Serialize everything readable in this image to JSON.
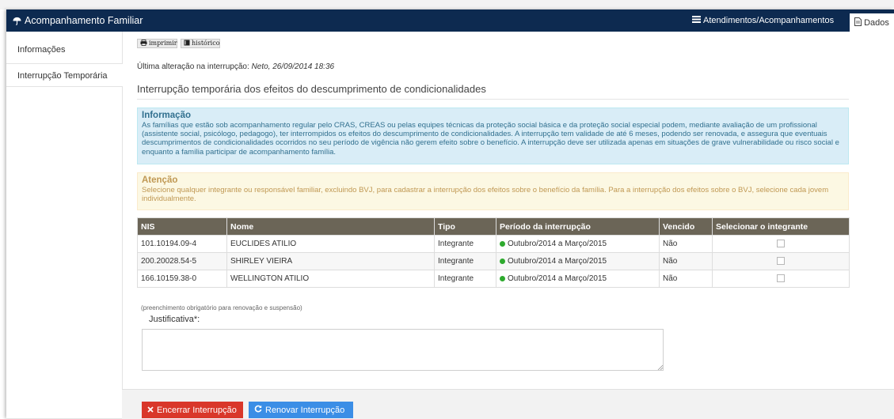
{
  "header": {
    "title": "Acompanhamento Familiar",
    "tabs": [
      {
        "label": "Atendimentos/Acompanhamentos",
        "icon": "list-icon"
      },
      {
        "label": "Dados",
        "icon": "document-icon",
        "active": true
      }
    ]
  },
  "sidebar": {
    "items": [
      {
        "label": "Informações"
      },
      {
        "label": "Interrupção Temporária",
        "active": true
      }
    ]
  },
  "toolbar": {
    "print_label": "imprimir",
    "history_label": "histórico"
  },
  "last_change": {
    "prefix": "Última alteração na interrupção:",
    "value": "Neto, 26/09/2014 18:36"
  },
  "page_title": "Interrupção temporária dos efeitos do descumprimento de condicionalidades",
  "info_alert": {
    "title": "Informação",
    "text": "As famílias que estão sob acompanhamento regular pelo CRAS, CREAS ou pelas equipes técnicas da proteção social básica e da proteção social especial podem, mediante avaliação de um profissional (assistente social, psicólogo, pedagogo), ter interrompidos os efeitos do descumprimento de condicionalidades. A interrupção tem validade de até 6 meses, podendo ser renovada, e assegura que eventuais descumprimentos de condicionalidades ocorridos no seu período de vigência não gerem efeito sobre o benefício. A interrupção deve ser utilizada apenas em situações de grave vulnerabilidade ou risco social e enquanto a família participar de acompanhamento família."
  },
  "warning_alert": {
    "title": "Atenção",
    "text": "Selecione qualquer integrante ou responsável familiar, excluindo BVJ, para cadastrar a interrupção dos efeitos sobre o benefício da família. Para a interrupção dos efeitos sobre o BVJ, selecione cada jovem individualmente."
  },
  "table": {
    "headers": [
      "NIS",
      "Nome",
      "Tipo",
      "Período da interrupção",
      "Vencido",
      "Selecionar o integrante"
    ],
    "rows": [
      {
        "nis": "101.10194.09-4",
        "nome": "EUCLIDES ATILIO",
        "tipo": "Integrante",
        "periodo": "Outubro/2014 a Março/2015",
        "vencido": "Não",
        "selected": false
      },
      {
        "nis": "200.20028.54-5",
        "nome": "SHIRLEY VIEIRA",
        "tipo": "Integrante",
        "periodo": "Outubro/2014 a Março/2015",
        "vencido": "Não",
        "selected": false
      },
      {
        "nis": "166.10159.38-0",
        "nome": "WELLINGTON ATILIO",
        "tipo": "Integrante",
        "periodo": "Outubro/2014 a Março/2015",
        "vencido": "Não",
        "selected": false
      }
    ],
    "status_color": "#2eaa2e"
  },
  "form": {
    "note": "(preenchimento obrigatório para renovação e suspensão)",
    "justification_label": "Justificativa*:",
    "justification_value": ""
  },
  "actions": {
    "end_label": "Encerrar Interrupção",
    "renew_label": "Renovar Interrupção",
    "end_color": "#d9372a",
    "renew_color": "#3b8ee6"
  }
}
